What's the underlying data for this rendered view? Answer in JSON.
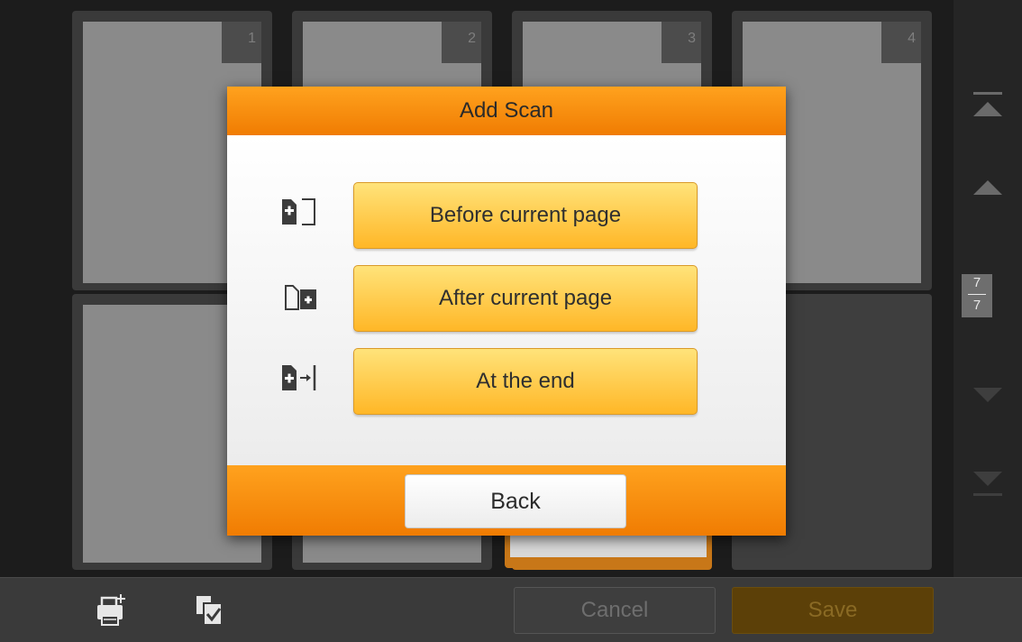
{
  "thumbnails": [
    {
      "number": "1"
    },
    {
      "number": "2"
    },
    {
      "number": "3"
    },
    {
      "number": "4"
    }
  ],
  "page_counter": {
    "current": "7",
    "total": "7"
  },
  "dialog": {
    "title": "Add Scan",
    "options": [
      {
        "label": "Before current page",
        "icon": "insert-before-icon"
      },
      {
        "label": "After current page",
        "icon": "insert-after-icon"
      },
      {
        "label": "At the end",
        "icon": "insert-end-icon"
      }
    ],
    "back_label": "Back"
  },
  "bottom_bar": {
    "cancel_label": "Cancel",
    "save_label": "Save",
    "icons": [
      "add-scan-printer-icon",
      "reorder-pages-icon"
    ]
  },
  "colors": {
    "accent": "#f58a0c",
    "button_yellow": "#ffcf4d",
    "background": "#1f1f1f"
  }
}
